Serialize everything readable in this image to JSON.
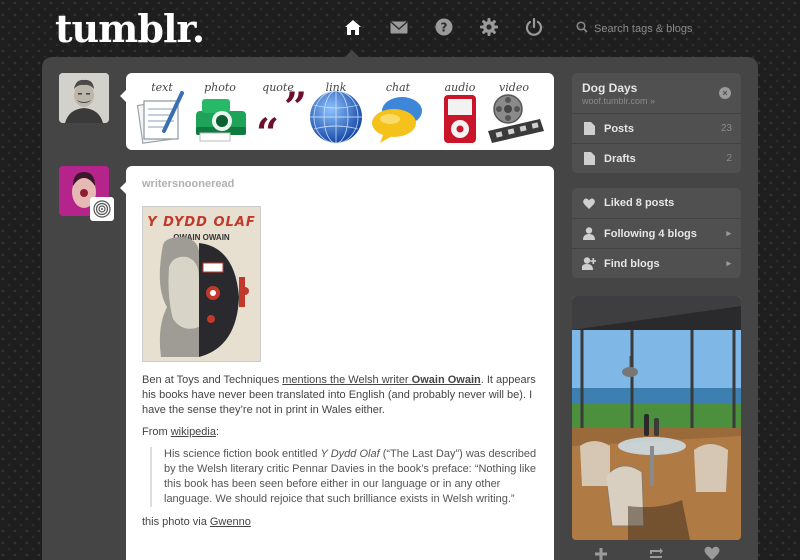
{
  "brand": {
    "logo_text": "tumblr."
  },
  "nav": {
    "items": [
      {
        "icon": "home-icon",
        "active": true
      },
      {
        "icon": "mail-icon"
      },
      {
        "icon": "help-icon"
      },
      {
        "icon": "gear-icon"
      },
      {
        "icon": "power-icon"
      }
    ],
    "search_placeholder": "Search tags & blogs"
  },
  "post_types": [
    {
      "label": "text",
      "icon": "text-post-icon"
    },
    {
      "label": "photo",
      "icon": "camera-icon"
    },
    {
      "label": "quote",
      "icon": "quote-icon"
    },
    {
      "label": "link",
      "icon": "globe-icon"
    },
    {
      "label": "chat",
      "icon": "chat-bubble-icon"
    },
    {
      "label": "audio",
      "icon": "ipod-icon"
    },
    {
      "label": "video",
      "icon": "film-reel-icon"
    }
  ],
  "post": {
    "author": "writersnooneread",
    "photo": {
      "book_title": "Y DYDD OLAF",
      "book_author": "OWAIN OWAIN"
    },
    "para1": {
      "t1": "Ben at Toys and Techniques ",
      "link1": "mentions the Welsh writer ",
      "link1_bold": "Owain Owain",
      "t2": ". It appears his books have never been translated into English (and probably never will be). I have the sense they’re not in print in Wales either."
    },
    "para2": {
      "t1": "From ",
      "link": "wikipedia",
      "t2": ":"
    },
    "quote": {
      "t1": "His science fiction book entitled ",
      "em": "Y Dydd Olaf",
      "t2": " (“The Last Day”) was described by the Welsh literary critic Pennar Davies in the book’s preface: “Nothing like this book has been seen before either in our language or in any other language. We should rejoice that such brilliance exists in Welsh writing.”"
    },
    "para3": {
      "t1": "this photo via ",
      "link": "Gwenno"
    }
  },
  "sidebar": {
    "blog": {
      "name": "Dog Days",
      "url": "woof.tumblr.com »"
    },
    "blog_rows": [
      {
        "label": "Posts",
        "count": "23",
        "icon": "document-icon"
      },
      {
        "label": "Drafts",
        "count": "2",
        "icon": "document-icon"
      }
    ],
    "activity_rows": [
      {
        "label": "Liked 8 posts",
        "icon": "heart-icon"
      },
      {
        "label": "Following 4 blogs",
        "icon": "person-icon",
        "chevron": "▸"
      },
      {
        "label": "Find blogs",
        "icon": "add-person-icon",
        "chevron": "▸"
      }
    ]
  },
  "colors": {
    "accent_quote": "#6b1030",
    "book_red": "#c0392b"
  }
}
